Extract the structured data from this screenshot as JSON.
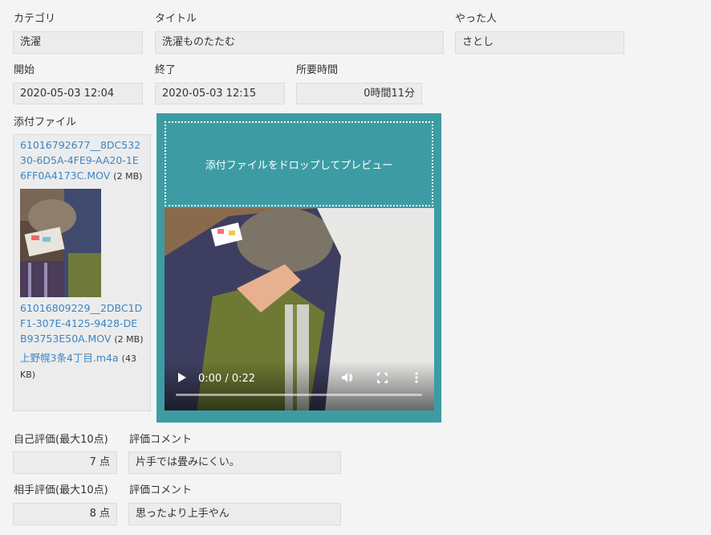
{
  "fields": {
    "category": {
      "label": "カテゴリ",
      "value": "洗濯"
    },
    "title": {
      "label": "タイトル",
      "value": "洗濯ものたたむ"
    },
    "doer": {
      "label": "やった人",
      "value": "さとし"
    },
    "start": {
      "label": "開始",
      "value": "2020-05-03 12:04"
    },
    "end": {
      "label": "終了",
      "value": "2020-05-03 12:15"
    },
    "duration": {
      "label": "所要時間",
      "value": "0時間11分"
    }
  },
  "attachments": {
    "label": "添付ファイル",
    "files": [
      {
        "name": "61016792677__8DC53230-6D5A-4FE9-AA20-1E6FF0A4173C.MOV",
        "size": "(2 MB)"
      },
      {
        "name": "61016809229__2DBC1DF1-307E-4125-9428-DEB93753E50A.MOV",
        "size": "(2 MB)"
      },
      {
        "name": "上野幌3条4丁目.m4a",
        "size": "(43 KB)"
      }
    ],
    "dropzone_text": "添付ファイルをドロップしてプレビュー"
  },
  "video": {
    "time": "0:00 / 0:22",
    "progress": 0
  },
  "evaluation": {
    "self": {
      "label": "自己評価(最大10点)",
      "value": "7 点",
      "comment_label": "評価コメント",
      "comment": "片手では畳みにくい。"
    },
    "partner": {
      "label": "相手評価(最大10点)",
      "value": "8 点",
      "comment_label": "評価コメント",
      "comment": "思ったより上手やん"
    }
  },
  "colors": {
    "accent": "#3d9ca3",
    "link": "#3a86c6"
  },
  "icons": [
    "play-icon",
    "volume-icon",
    "fullscreen-icon",
    "more-vert-icon"
  ]
}
